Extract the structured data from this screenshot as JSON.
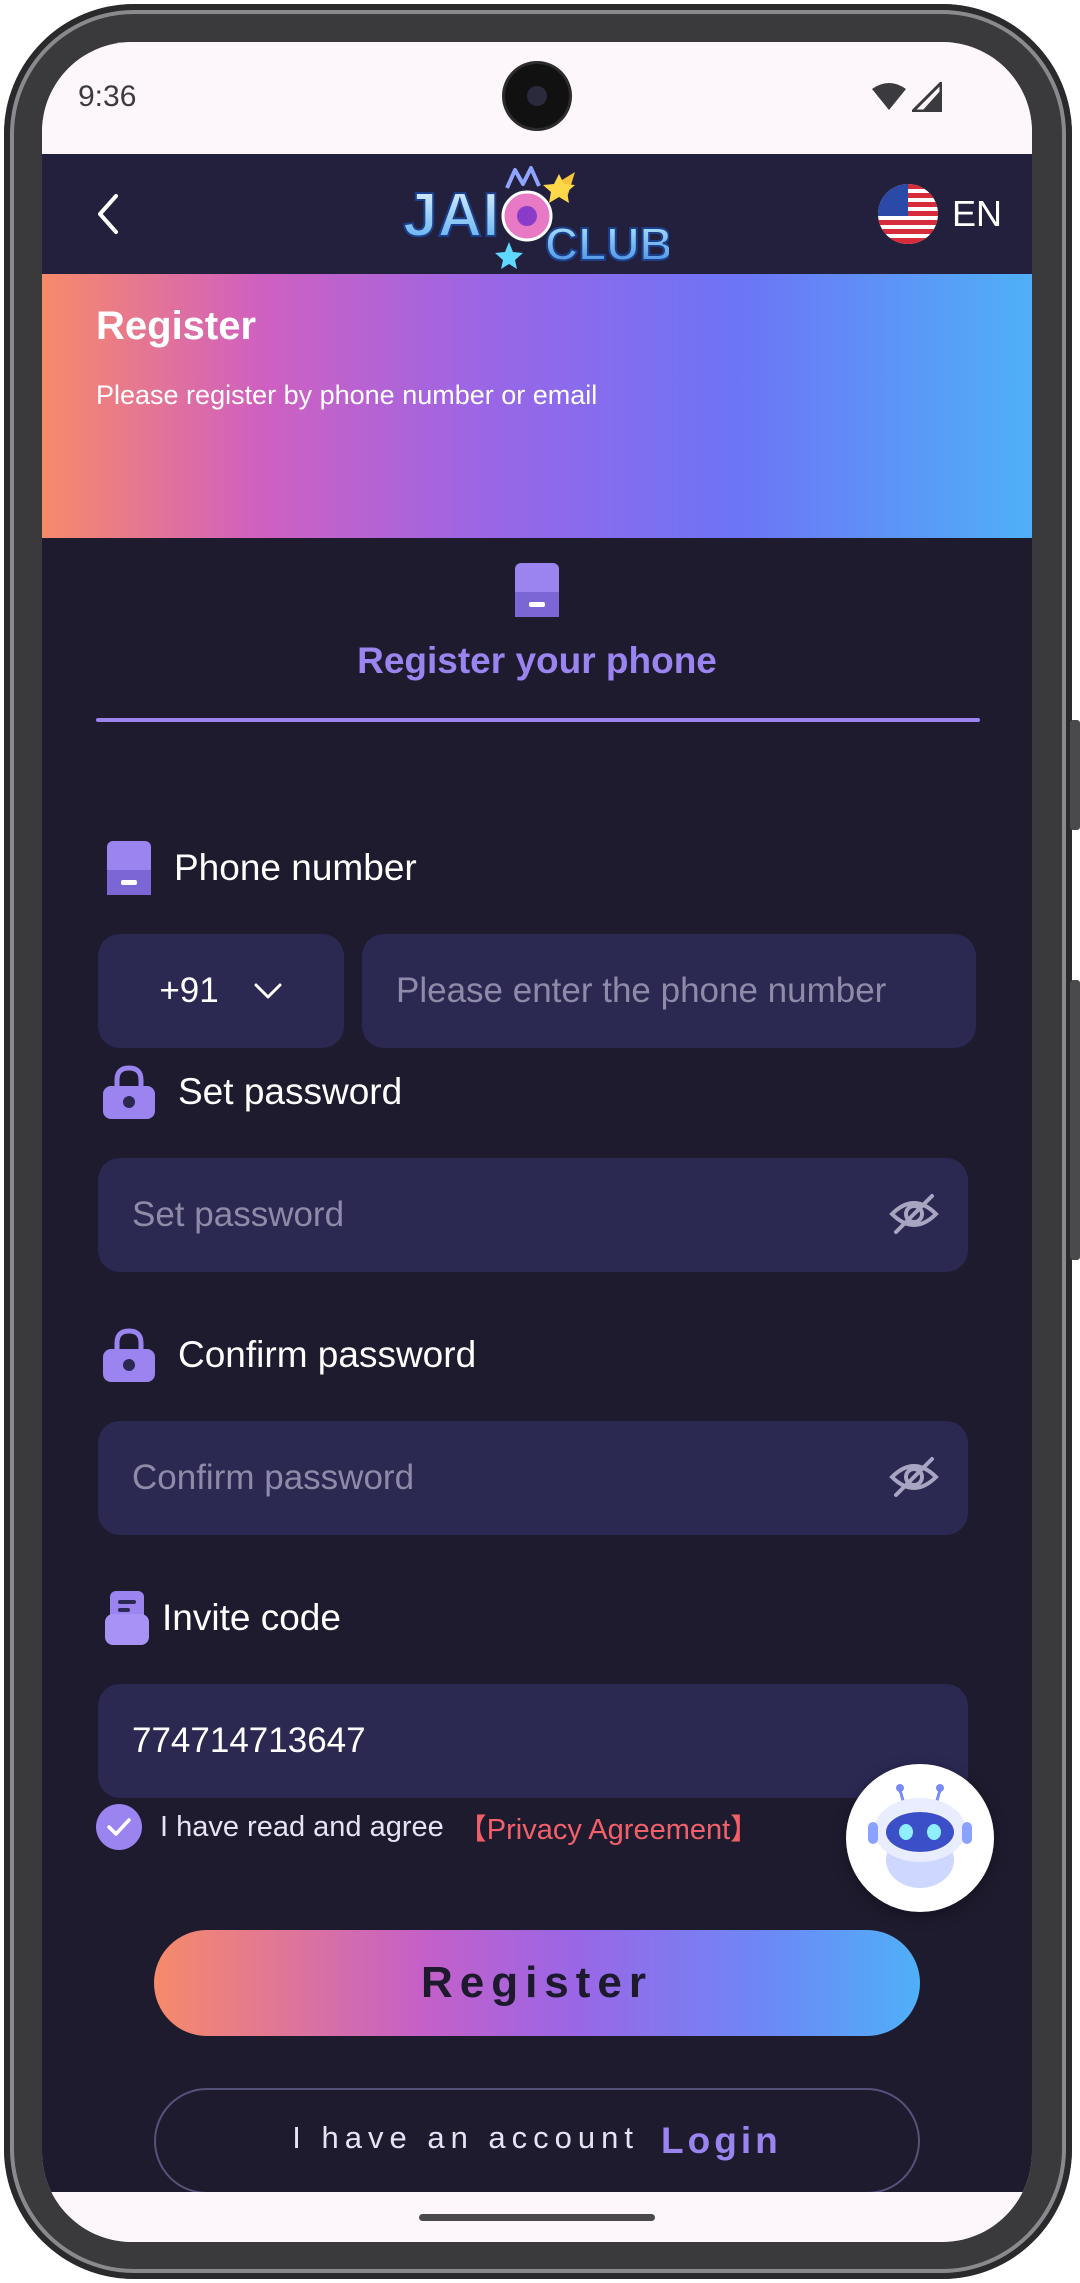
{
  "status_bar": {
    "time": "9:36"
  },
  "header": {
    "logo_text": "JAI CLUB",
    "language": "EN",
    "back_icon": "chevron-left-icon",
    "flag_icon": "us-flag-icon"
  },
  "hero": {
    "title": "Register",
    "subtitle": "Please register by phone number or email"
  },
  "tab": {
    "label": "Register your phone"
  },
  "form": {
    "phone_label": "Phone number",
    "country_code": "+91",
    "phone_placeholder": "Please enter the phone number",
    "password_label": "Set password",
    "password_placeholder": "Set password",
    "confirm_label": "Confirm password",
    "confirm_placeholder": "Confirm password",
    "invite_label": "Invite code",
    "invite_value": "774714713647"
  },
  "agreement": {
    "text": "I have read and agree",
    "link": "【Privacy Agreement】",
    "checked": true
  },
  "actions": {
    "register_label": "Register",
    "have_account_text": "I have an account",
    "login_label": "Login"
  },
  "colors": {
    "background": "#1e1b2e",
    "input": "#2b2852",
    "accent": "#9b84f0",
    "link_red": "#f2606a"
  }
}
